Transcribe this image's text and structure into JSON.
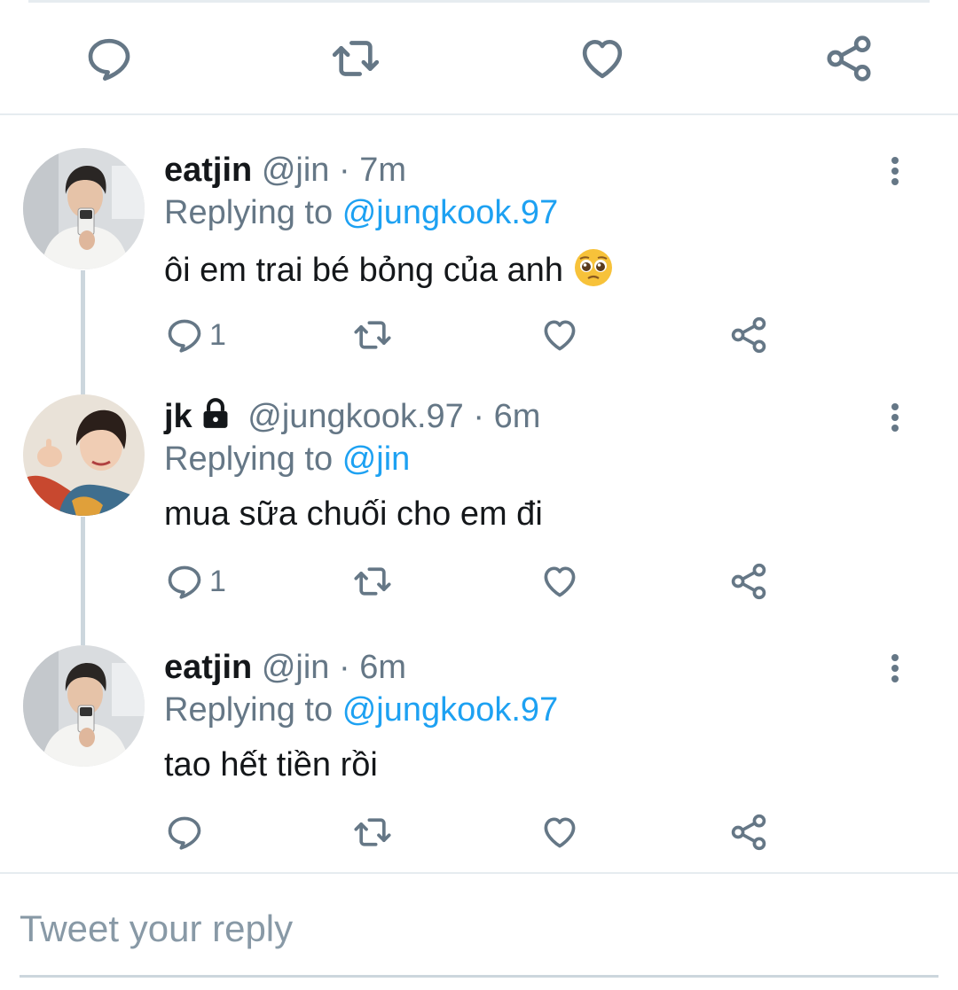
{
  "main_actions": {
    "reply_icon": "comment-icon",
    "retweet_icon": "retweet-icon",
    "like_icon": "heart-icon",
    "share_icon": "share-icon"
  },
  "replies": [
    {
      "name": "eatjin",
      "handle": "@jin",
      "separator": "·",
      "time": "7m",
      "replying_prefix": "Replying to",
      "replying_to": "@jungkook.97",
      "text": "ôi em trai bé bỏng của anh",
      "emoji": "🥺",
      "reply_count": "1",
      "protected": false
    },
    {
      "name": "jk",
      "handle": "@jungkook.97",
      "separator": "·",
      "time": "6m",
      "replying_prefix": "Replying to",
      "replying_to": "@jin",
      "text": "mua sữa chuối cho em đi",
      "reply_count": "1",
      "protected": true
    },
    {
      "name": "eatjin",
      "handle": "@jin",
      "separator": "·",
      "time": "6m",
      "replying_prefix": "Replying to",
      "replying_to": "@jungkook.97",
      "text": "tao hết tiền rồi",
      "reply_count": "",
      "protected": false
    }
  ],
  "compose": {
    "placeholder": "Tweet your reply"
  },
  "colors": {
    "link": "#1da1f2",
    "secondary": "#657786",
    "divider": "#e6ecf0",
    "thread_line": "#ccd6dd"
  }
}
